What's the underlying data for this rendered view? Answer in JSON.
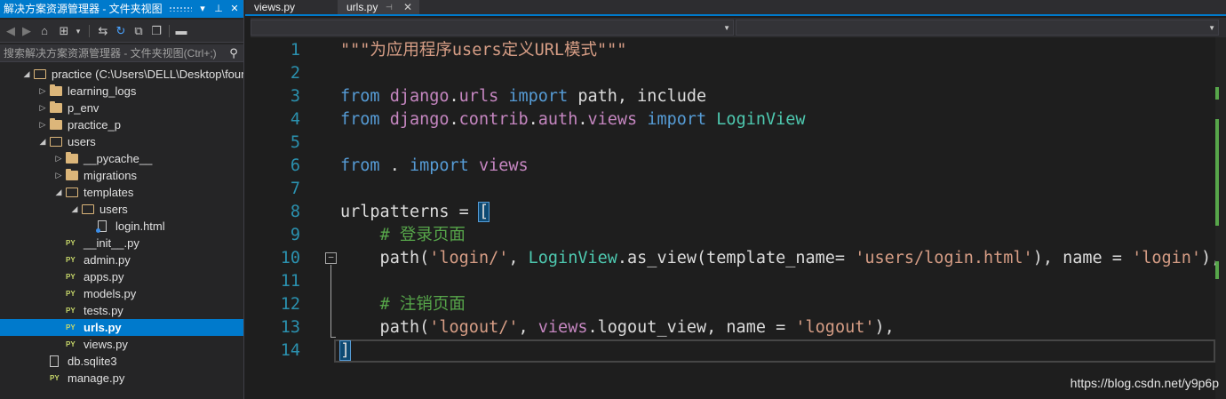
{
  "explorer": {
    "title": "解决方案资源管理器 - 文件夹视图",
    "search_placeholder": "搜索解决方案资源管理器 - 文件夹视图(Ctrl+;)",
    "tree": [
      {
        "label": "practice (C:\\Users\\DELL\\Desktop\\four\\",
        "depth": 0,
        "icon": "project-folder-icon",
        "arrow": "expanded"
      },
      {
        "label": "learning_logs",
        "depth": 1,
        "icon": "folder-icon",
        "arrow": "collapsed"
      },
      {
        "label": "p_env",
        "depth": 1,
        "icon": "folder-icon",
        "arrow": "collapsed"
      },
      {
        "label": "practice_p",
        "depth": 1,
        "icon": "folder-icon",
        "arrow": "collapsed"
      },
      {
        "label": "users",
        "depth": 1,
        "icon": "folder-open-icon",
        "arrow": "expanded"
      },
      {
        "label": "__pycache__",
        "depth": 2,
        "icon": "folder-icon",
        "arrow": "collapsed"
      },
      {
        "label": "migrations",
        "depth": 2,
        "icon": "folder-icon",
        "arrow": "collapsed"
      },
      {
        "label": "templates",
        "depth": 2,
        "icon": "folder-open-icon",
        "arrow": "expanded"
      },
      {
        "label": "users",
        "depth": 3,
        "icon": "folder-open-icon",
        "arrow": "expanded"
      },
      {
        "label": "login.html",
        "depth": 4,
        "icon": "html-file-icon",
        "arrow": "none"
      },
      {
        "label": "__init__.py",
        "depth": 2,
        "icon": "python-file-icon",
        "arrow": "none"
      },
      {
        "label": "admin.py",
        "depth": 2,
        "icon": "python-file-icon",
        "arrow": "none"
      },
      {
        "label": "apps.py",
        "depth": 2,
        "icon": "python-file-icon",
        "arrow": "none"
      },
      {
        "label": "models.py",
        "depth": 2,
        "icon": "python-file-icon",
        "arrow": "none"
      },
      {
        "label": "tests.py",
        "depth": 2,
        "icon": "python-file-icon",
        "arrow": "none"
      },
      {
        "label": "urls.py",
        "depth": 2,
        "icon": "python-file-icon",
        "arrow": "none",
        "selected": true
      },
      {
        "label": "views.py",
        "depth": 2,
        "icon": "python-file-icon",
        "arrow": "none"
      },
      {
        "label": "db.sqlite3",
        "depth": 1,
        "icon": "file-icon",
        "arrow": "none"
      },
      {
        "label": "manage.py",
        "depth": 1,
        "icon": "python-file-icon",
        "arrow": "none"
      }
    ]
  },
  "tabs": [
    {
      "label": "views.py",
      "active": false
    },
    {
      "label": "urls.py",
      "active": true
    }
  ],
  "py_badge": "PY",
  "icons": {
    "pin": "pin-icon",
    "close": "close-icon",
    "dropdown": "chevron-down-icon",
    "back": "back-icon",
    "forward": "forward-icon",
    "home": "home-icon",
    "sync": "sync-icon",
    "refresh": "refresh-icon",
    "collapse": "collapse-all-icon",
    "copy": "copy-icon",
    "search": "search-icon",
    "fold": "fold-minus-icon"
  },
  "code": {
    "lines": [
      {
        "n": "1",
        "tokens": [
          [
            "doc",
            "\"\"\"为应用程序users定义URL模式\"\"\""
          ]
        ]
      },
      {
        "n": "2",
        "tokens": []
      },
      {
        "n": "3",
        "tokens": [
          [
            "kw",
            "from"
          ],
          [
            "plain",
            " "
          ],
          [
            "mod",
            "django"
          ],
          [
            "plain",
            "."
          ],
          [
            "mod",
            "urls"
          ],
          [
            "plain",
            " "
          ],
          [
            "kw",
            "import"
          ],
          [
            "plain",
            " path, include"
          ]
        ]
      },
      {
        "n": "4",
        "tokens": [
          [
            "kw",
            "from"
          ],
          [
            "plain",
            " "
          ],
          [
            "mod",
            "django"
          ],
          [
            "plain",
            "."
          ],
          [
            "mod",
            "contrib"
          ],
          [
            "plain",
            "."
          ],
          [
            "mod",
            "auth"
          ],
          [
            "plain",
            "."
          ],
          [
            "mod",
            "views"
          ],
          [
            "plain",
            " "
          ],
          [
            "kw",
            "import"
          ],
          [
            "plain",
            " "
          ],
          [
            "cls",
            "LoginView"
          ]
        ]
      },
      {
        "n": "5",
        "tokens": []
      },
      {
        "n": "6",
        "tokens": [
          [
            "kw",
            "from"
          ],
          [
            "plain",
            " . "
          ],
          [
            "kw",
            "import"
          ],
          [
            "plain",
            " "
          ],
          [
            "mod",
            "views"
          ]
        ]
      },
      {
        "n": "7",
        "tokens": []
      },
      {
        "n": "8",
        "tokens": [
          [
            "plain",
            "urlpatterns = "
          ],
          [
            "bracket-hl",
            "["
          ]
        ]
      },
      {
        "n": "9",
        "tokens": [
          [
            "plain",
            "    "
          ],
          [
            "cmt",
            "# 登录页面"
          ]
        ]
      },
      {
        "n": "10",
        "tokens": [
          [
            "plain",
            "    path("
          ],
          [
            "str",
            "'login/'"
          ],
          [
            "plain",
            ", "
          ],
          [
            "cls",
            "LoginView"
          ],
          [
            "plain",
            ".as_view(template_name= "
          ],
          [
            "str",
            "'users/login.html'"
          ],
          [
            "plain",
            "), name = "
          ],
          [
            "str",
            "'login'"
          ],
          [
            "plain",
            "),"
          ]
        ]
      },
      {
        "n": "11",
        "tokens": []
      },
      {
        "n": "12",
        "tokens": [
          [
            "plain",
            "    "
          ],
          [
            "cmt",
            "# 注销页面"
          ]
        ]
      },
      {
        "n": "13",
        "tokens": [
          [
            "plain",
            "    path("
          ],
          [
            "str",
            "'logout/'"
          ],
          [
            "plain",
            ", "
          ],
          [
            "mod",
            "views"
          ],
          [
            "plain",
            ".logout_view, name = "
          ],
          [
            "str",
            "'logout'"
          ],
          [
            "plain",
            "),"
          ]
        ]
      },
      {
        "n": "14",
        "tokens": [
          [
            "bracket-hl",
            "]"
          ]
        ]
      }
    ]
  },
  "watermark": "https://blog.csdn.net/y9p6p",
  "colors": {
    "accent": "#007acc",
    "keyword": "#569cd6",
    "module": "#c586c0",
    "class": "#4ec9b0",
    "string": "#d69d85",
    "comment": "#57a64a",
    "line_number": "#2b91af"
  }
}
